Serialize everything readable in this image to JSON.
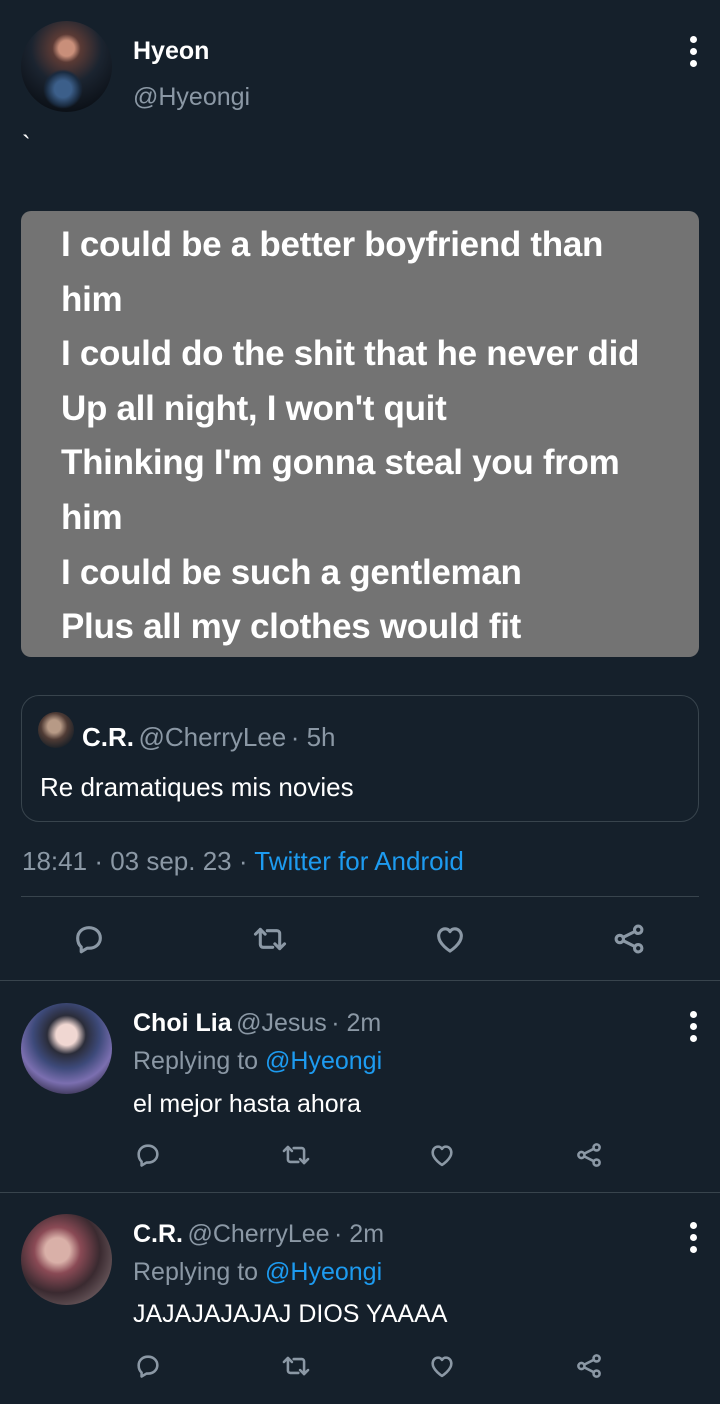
{
  "tweet": {
    "author_name": "Hyeon",
    "author_handle": "@Hyeongi",
    "text": "`",
    "lyrics": [
      "I could be a better boyfriend than",
      "him",
      "I could do the shit that he never did",
      "Up all night, I won't quit",
      "Thinking I'm gonna steal you from",
      "him",
      "I could be such a gentleman",
      "Plus all my clothes would fit"
    ],
    "quote": {
      "name": "C.R.",
      "handle": "@CherryLee",
      "time": "· 5h",
      "text": "Re dramatiques mis novies"
    },
    "time": "18:41",
    "date": "· 03 sep. 23 ·",
    "source": "Twitter for Android"
  },
  "replies": [
    {
      "name": "Choi Lia",
      "handle": "@Jesus",
      "time": "· 2m",
      "replying_prefix": "Replying to",
      "replying_to": "@Hyeongi",
      "text": "el mejor hasta ahora"
    },
    {
      "name": "C.R.",
      "handle": "@CherryLee",
      "time": "· 2m",
      "replying_prefix": "Replying to",
      "replying_to": "@Hyeongi",
      "text": "JAJAJAJAJAJ DIOS YAAAA"
    }
  ],
  "icons": {
    "reply": "comment-icon",
    "retweet": "retweet-icon",
    "like": "heart-icon",
    "share": "share-icon",
    "more": "more-vertical-icon"
  },
  "colors": {
    "background": "#15202b",
    "accent": "#1d9bf0",
    "muted": "#8b98a5",
    "card": "#737373",
    "border": "#38444d"
  }
}
